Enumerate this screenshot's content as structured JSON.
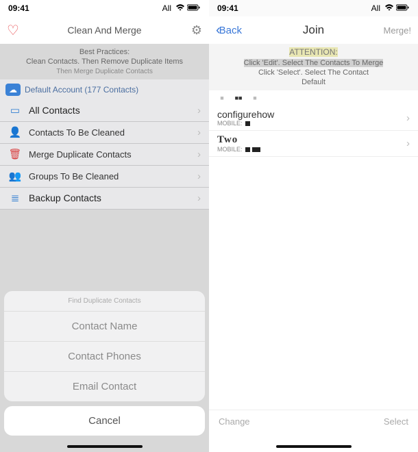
{
  "left": {
    "status": {
      "time": "09:41",
      "carrier": "All"
    },
    "nav": {
      "title": "Clean And Merge"
    },
    "info": {
      "line1": "Best Practices:",
      "line2": "Clean Contacts. Then Remove Duplicate Items",
      "line3": "Then Merge Duplicate Contacts"
    },
    "account": {
      "label": "Default Account (177 Contacts)"
    },
    "menu": [
      {
        "icon": "id-card-icon",
        "label": "All Contacts",
        "bold": true
      },
      {
        "icon": "person-clean-icon",
        "label": "Contacts To Be Cleaned",
        "bold": false
      },
      {
        "icon": "trash-icon",
        "label": "Merge Duplicate Contacts",
        "bold": false
      },
      {
        "icon": "group-clean-icon",
        "label": "Groups To Be Cleaned",
        "bold": false
      },
      {
        "icon": "backup-icon",
        "label": "Backup Contacts",
        "bold": true
      }
    ],
    "sheet": {
      "title": "Find Duplicate Contacts",
      "items": [
        "Contact Name",
        "Contact Phones",
        "Email Contact"
      ],
      "cancel": "Cancel"
    }
  },
  "right": {
    "status": {
      "time": "09:41",
      "carrier": "All"
    },
    "nav": {
      "back": "Back",
      "title": "Join",
      "action": "Merge!"
    },
    "info": {
      "attention": "ATTENTION:",
      "line1": "Click 'Edit'. Select The Contacts To Merge",
      "line2": "Click 'Select'. Select The Contact",
      "line3": "Default"
    },
    "contacts": [
      {
        "name": "configurehow",
        "sub": "MOBILE:",
        "style": "normal"
      },
      {
        "name": "Two",
        "sub": "MOBILE:",
        "style": "serif"
      }
    ],
    "bottom": {
      "left": "Change",
      "right": "Select"
    }
  }
}
